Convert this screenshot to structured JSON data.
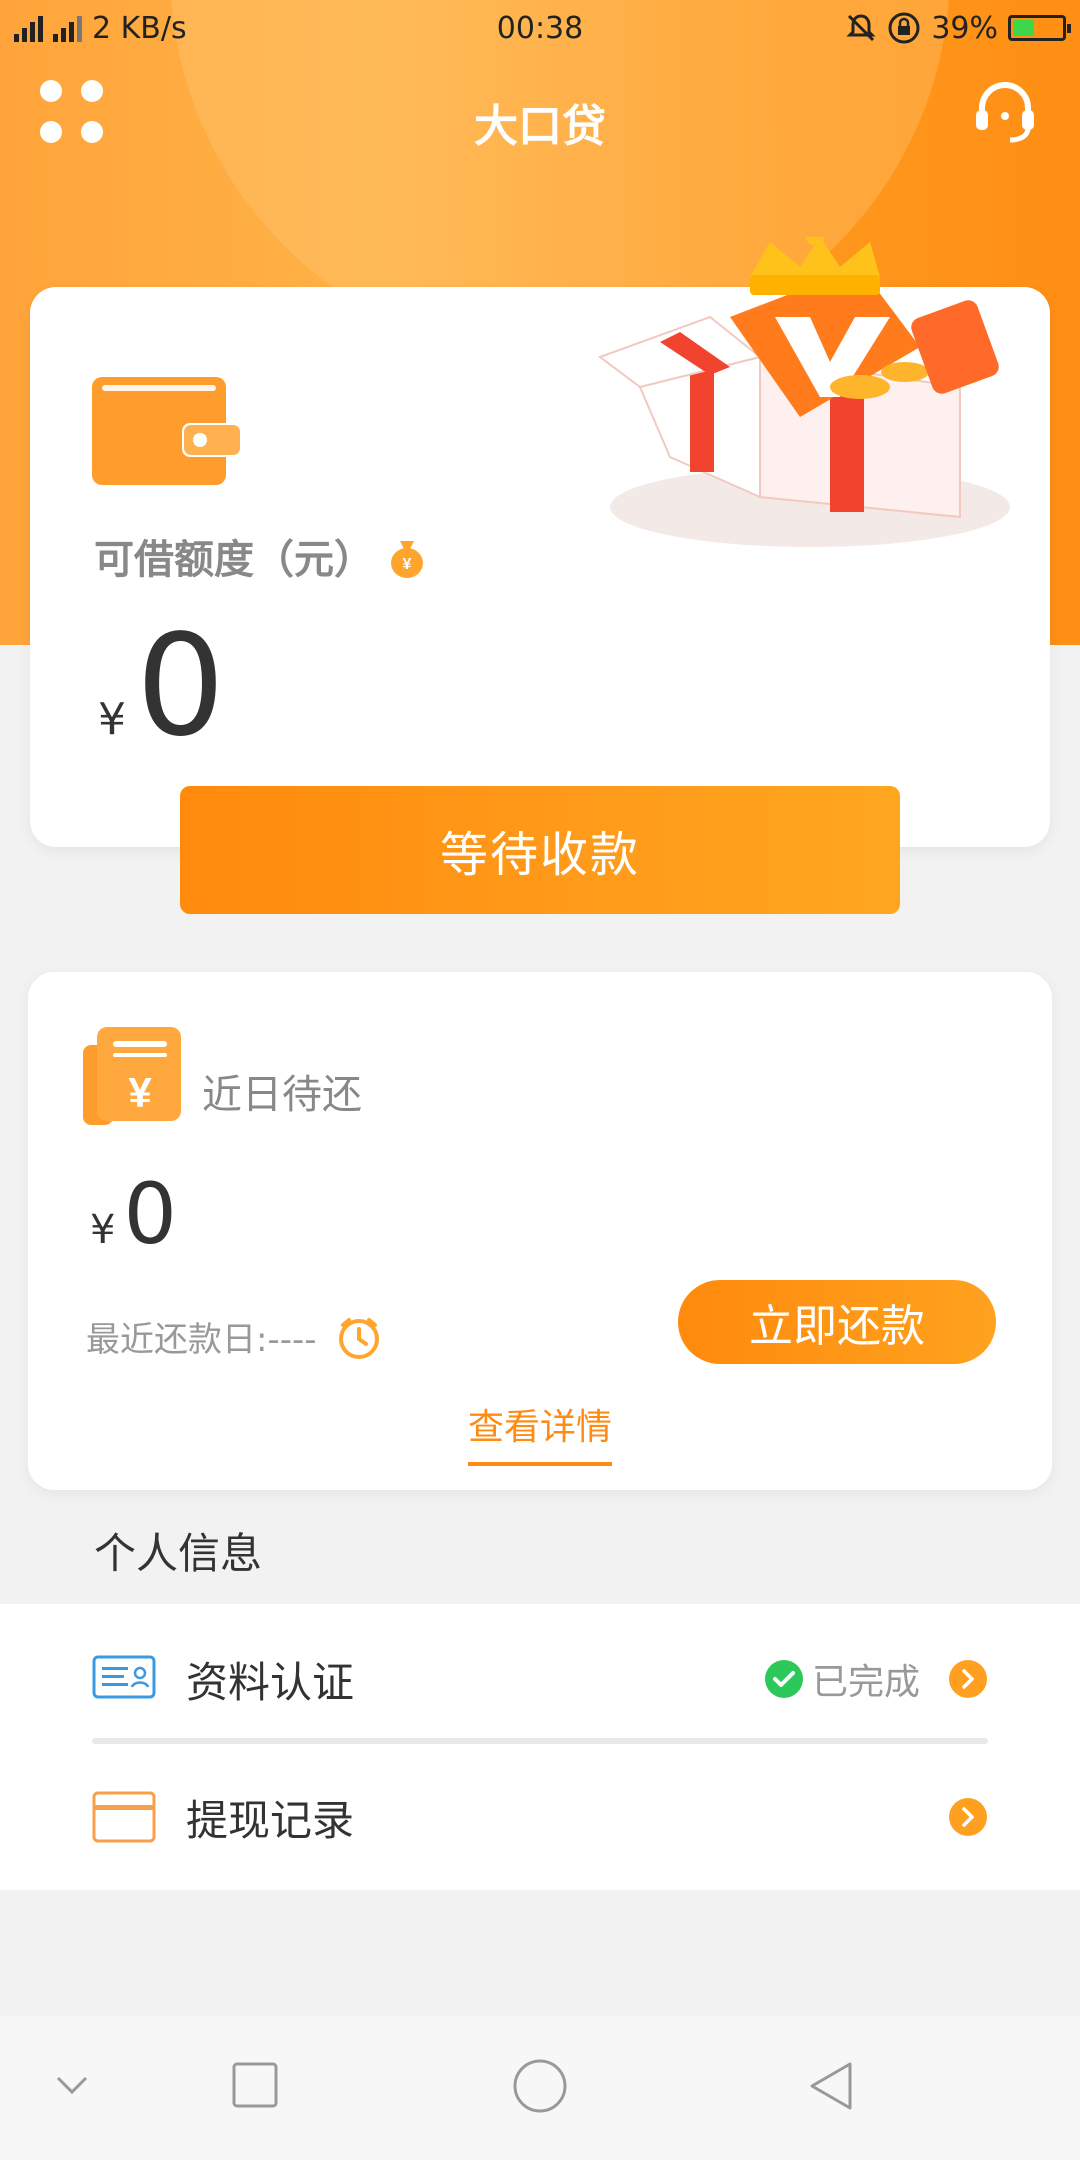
{
  "status_bar": {
    "net_types": "4G 2G",
    "speed": "2 KB/s",
    "time": "00:38",
    "battery": "39%"
  },
  "header": {
    "title": "大口贷"
  },
  "credit_card": {
    "label": "可借额度（元）",
    "currency": "¥",
    "amount": "0",
    "button_label": "等待收款"
  },
  "repay_card": {
    "label": "近日待还",
    "currency": "¥",
    "amount": "0",
    "due_text": "最近还款日:----",
    "repay_button": "立即还款",
    "details_link": "查看详情"
  },
  "personal": {
    "section_title": "个人信息",
    "items": [
      {
        "label": "资料认证",
        "status": "已完成",
        "icon": "id-card-icon"
      },
      {
        "label": "提现记录",
        "status": "",
        "icon": "card-icon"
      }
    ]
  },
  "colors": {
    "accent": "#ff8b13",
    "hero": "#ffa43a",
    "success": "#2dc85a"
  }
}
